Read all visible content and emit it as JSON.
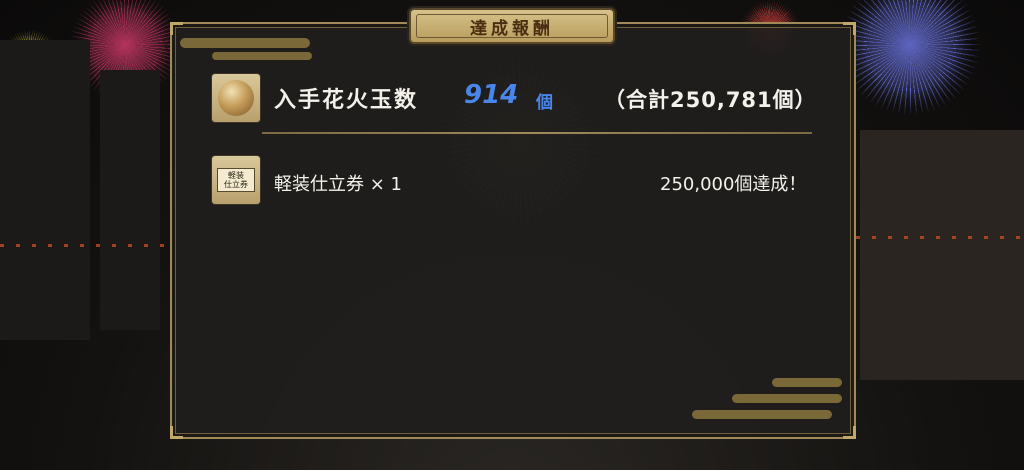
{
  "dialog": {
    "title": "達成報酬"
  },
  "summary": {
    "label": "入手花火玉数",
    "count": "914",
    "unit": "個",
    "grand_total": "（合計250,781個）"
  },
  "rewards": [
    {
      "icon": "ticket-icon",
      "icon_text_top": "軽装",
      "icon_text_bottom": "仕立券",
      "label": "軽装仕立券 × 1",
      "condition": "250,000個達成！"
    }
  ],
  "colors": {
    "panel_border": "#a08a58",
    "accent_number": "#4a86ea",
    "title_plate": "#cdb57a"
  }
}
